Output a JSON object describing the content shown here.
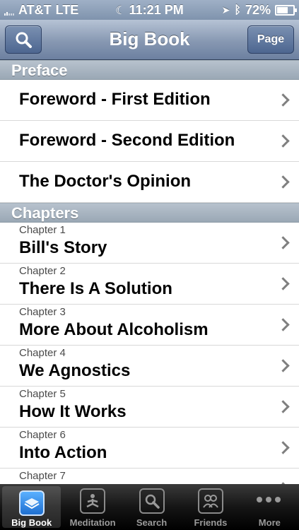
{
  "status": {
    "carrier": "AT&T",
    "network": "LTE",
    "time": "11:21 PM",
    "battery": "72%"
  },
  "nav": {
    "title": "Big Book",
    "page_label": "Page"
  },
  "sections": {
    "preface": {
      "header": "Preface",
      "items": [
        "Foreword - First Edition",
        "Foreword - Second Edition",
        "The Doctor's Opinion"
      ]
    },
    "chapters": {
      "header": "Chapters",
      "items": [
        {
          "chapter": "Chapter 1",
          "title": "Bill's Story"
        },
        {
          "chapter": "Chapter 2",
          "title": "There Is A Solution"
        },
        {
          "chapter": "Chapter 3",
          "title": "More About Alcoholism"
        },
        {
          "chapter": "Chapter 4",
          "title": "We Agnostics"
        },
        {
          "chapter": "Chapter 5",
          "title": "How It Works"
        },
        {
          "chapter": "Chapter 6",
          "title": "Into Action"
        },
        {
          "chapter": "Chapter 7",
          "title": ""
        }
      ]
    }
  },
  "tabs": [
    {
      "label": "Big Book",
      "icon": "book-icon",
      "active": true
    },
    {
      "label": "Meditation",
      "icon": "meditation-icon",
      "active": false
    },
    {
      "label": "Search",
      "icon": "search-icon",
      "active": false
    },
    {
      "label": "Friends",
      "icon": "friends-icon",
      "active": false
    },
    {
      "label": "More",
      "icon": "more-icon",
      "active": false
    }
  ]
}
